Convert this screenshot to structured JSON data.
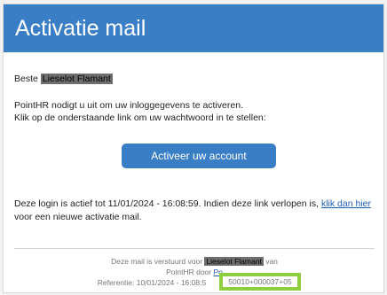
{
  "header": {
    "title": "Activatie mail"
  },
  "greeting": {
    "prefix": "Beste",
    "name": "Lieselot Flamant"
  },
  "intro": {
    "line1": "PointHR nodigt u uit om uw inloggegevens te activeren.",
    "line2": "Klik op de onderstaande link om uw wachtwoord in te stellen:"
  },
  "activate_button": {
    "label": "Activeer uw account"
  },
  "expiry": {
    "text": "Deze login is actief tot 11/01/2024 - 16:08:59. Indien deze link verlopen is,",
    "link": "klik dan hier",
    "line2": "voor een nieuwe activatie mail."
  },
  "footer": {
    "sent_prefix": "Deze mail is verstuurd voor",
    "sent_name": "Lieselot Flamant",
    "sent_suffix": "van",
    "by_prefix": "PointHR door",
    "by_link": "Po",
    "reference_prefix": "Referentie: 10/01/2024 - 16:08:5",
    "reference_highlight": "50010+000037+05"
  },
  "colors": {
    "brand": "#3a7ec6",
    "link": "#1f5fb0",
    "highlight": "#8fce3e",
    "redaction": "#6e6e6e"
  }
}
